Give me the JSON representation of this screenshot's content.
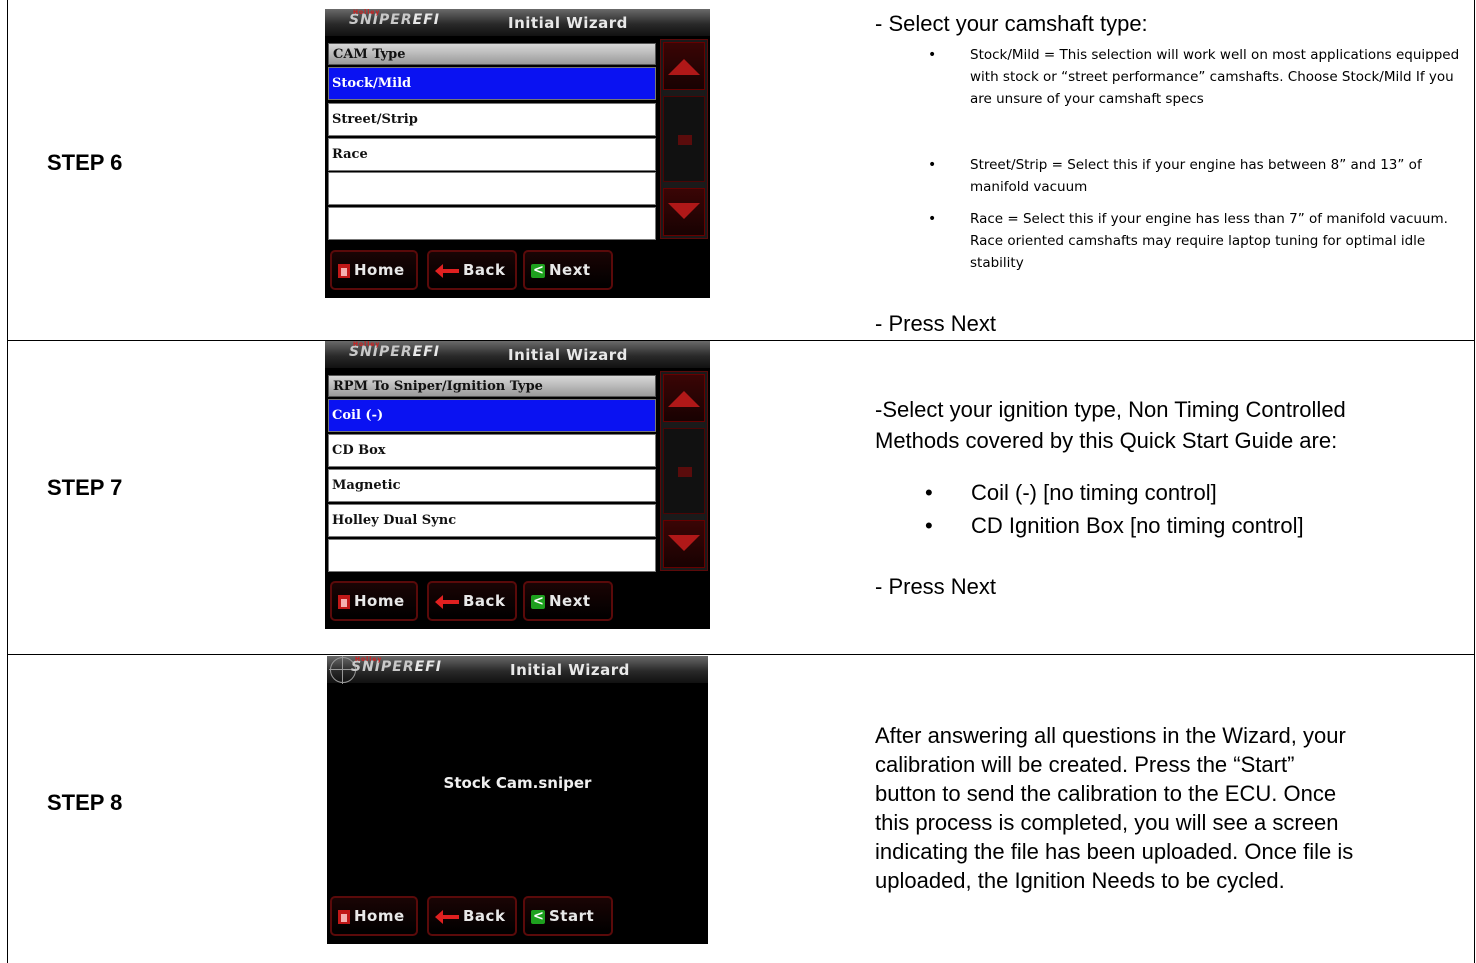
{
  "steps": [
    {
      "label": "STEP 6",
      "screen": {
        "title": "Initial Wizard",
        "logo_text": "SNIPER",
        "logo_efi": "EFI",
        "logo_brand": "Holley",
        "list_header": "CAM Type",
        "items": [
          "Stock/Mild",
          "Street/Strip",
          "Race",
          "",
          ""
        ],
        "selected_index": 0,
        "buttons": [
          "Home",
          "Back",
          "Next"
        ]
      },
      "heading": "- Select your camshaft type:",
      "bullets": [
        "Stock/Mild = This selection will work well on most applications equipped with stock or “street performance” camshafts.  Choose Stock/Mild If you are unsure of your camshaft specs",
        "Street/Strip = Select this if your engine has between 8” and 13” of manifold vacuum",
        "Race = Select this if your engine has less than 7” of manifold vacuum.  Race oriented camshafts may require laptop tuning for optimal idle stability"
      ],
      "footer": "- Press Next"
    },
    {
      "label": "STEP 7",
      "screen": {
        "title": "Initial Wizard",
        "logo_text": "SNIPER",
        "logo_efi": "EFI",
        "logo_brand": "Holley",
        "list_header": "RPM To Sniper/Ignition Type",
        "items": [
          "Coil (-)",
          "CD Box",
          "Magnetic",
          "Holley Dual Sync",
          ""
        ],
        "selected_index": 0,
        "buttons": [
          "Home",
          "Back",
          "Next"
        ]
      },
      "heading_line1": "-Select your ignition type, Non Timing Controlled",
      "heading_line2": "Methods covered by this Quick Start Guide are:",
      "bullets": [
        "Coil (-) [no timing control]",
        "CD Ignition Box [no timing control]"
      ],
      "footer": "- Press Next"
    },
    {
      "label": "STEP 8",
      "screen": {
        "title": "Initial Wizard",
        "logo_text": "SNIPER",
        "logo_efi": "EFI",
        "logo_brand": "Holley",
        "file_name": "Stock Cam.sniper",
        "buttons": [
          "Home",
          "Back",
          "Start"
        ]
      },
      "lines": [
        "After answering all questions in the Wizard, your",
        "calibration will be created.  Press the “Start”",
        "button to send the calibration to the ECU. Once",
        "this process is completed, you will see a screen",
        "indicating the file has been uploaded.  Once file is",
        "uploaded, the Ignition Needs to be cycled."
      ]
    }
  ]
}
